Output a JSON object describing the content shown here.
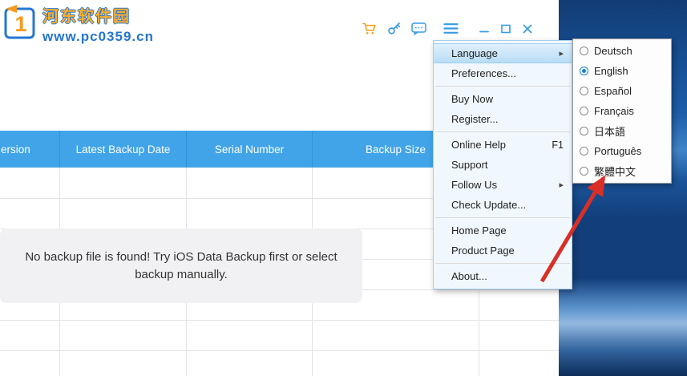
{
  "watermark": {
    "site_name": "河东软件园",
    "site_url": "www.pc0359.cn"
  },
  "titlebar": {
    "icons": [
      {
        "name": "cart-icon",
        "color": "#f5a01e"
      },
      {
        "name": "key-icon",
        "color": "#369ce2"
      },
      {
        "name": "message-icon",
        "color": "#369ce2"
      },
      {
        "name": "hamburger-menu-icon",
        "color": "#369ce2"
      }
    ],
    "window_controls": [
      "minimize",
      "maximize",
      "close"
    ]
  },
  "table": {
    "columns": [
      {
        "label": "ersion"
      },
      {
        "label": "Latest Backup Date"
      },
      {
        "label": "Serial Number"
      },
      {
        "label": "Backup Size"
      },
      {
        "label": ""
      }
    ]
  },
  "message": {
    "text": "No backup file is found! Try iOS Data Backup first or select backup manually."
  },
  "menu": {
    "items": [
      {
        "label": "Language",
        "has_submenu": true,
        "highlighted": true
      },
      {
        "label": "Preferences...",
        "separator_after": true
      },
      {
        "label": "Buy Now"
      },
      {
        "label": "Register...",
        "separator_after": true
      },
      {
        "label": "Online Help",
        "shortcut": "F1"
      },
      {
        "label": "Support"
      },
      {
        "label": "Follow Us",
        "has_submenu": true
      },
      {
        "label": "Check Update...",
        "separator_after": true
      },
      {
        "label": "Home Page"
      },
      {
        "label": "Product Page",
        "separator_after": true
      },
      {
        "label": "About..."
      }
    ],
    "submenu_arrow": "▸"
  },
  "language_submenu": {
    "options": [
      {
        "label": "Deutsch",
        "selected": false
      },
      {
        "label": "English",
        "selected": true
      },
      {
        "label": "Español",
        "selected": false
      },
      {
        "label": "Français",
        "selected": false
      },
      {
        "label": "日本語",
        "selected": false
      },
      {
        "label": "Português",
        "selected": false
      },
      {
        "label": "繁體中文",
        "selected": false
      }
    ]
  },
  "colors": {
    "header_blue": "#41a4e8",
    "accent_blue": "#369ce2",
    "menu_bg": "#f0f8fe",
    "highlight": "#c9e6f9",
    "arrow_red": "#d92f26",
    "cart_orange": "#f5a01e"
  }
}
